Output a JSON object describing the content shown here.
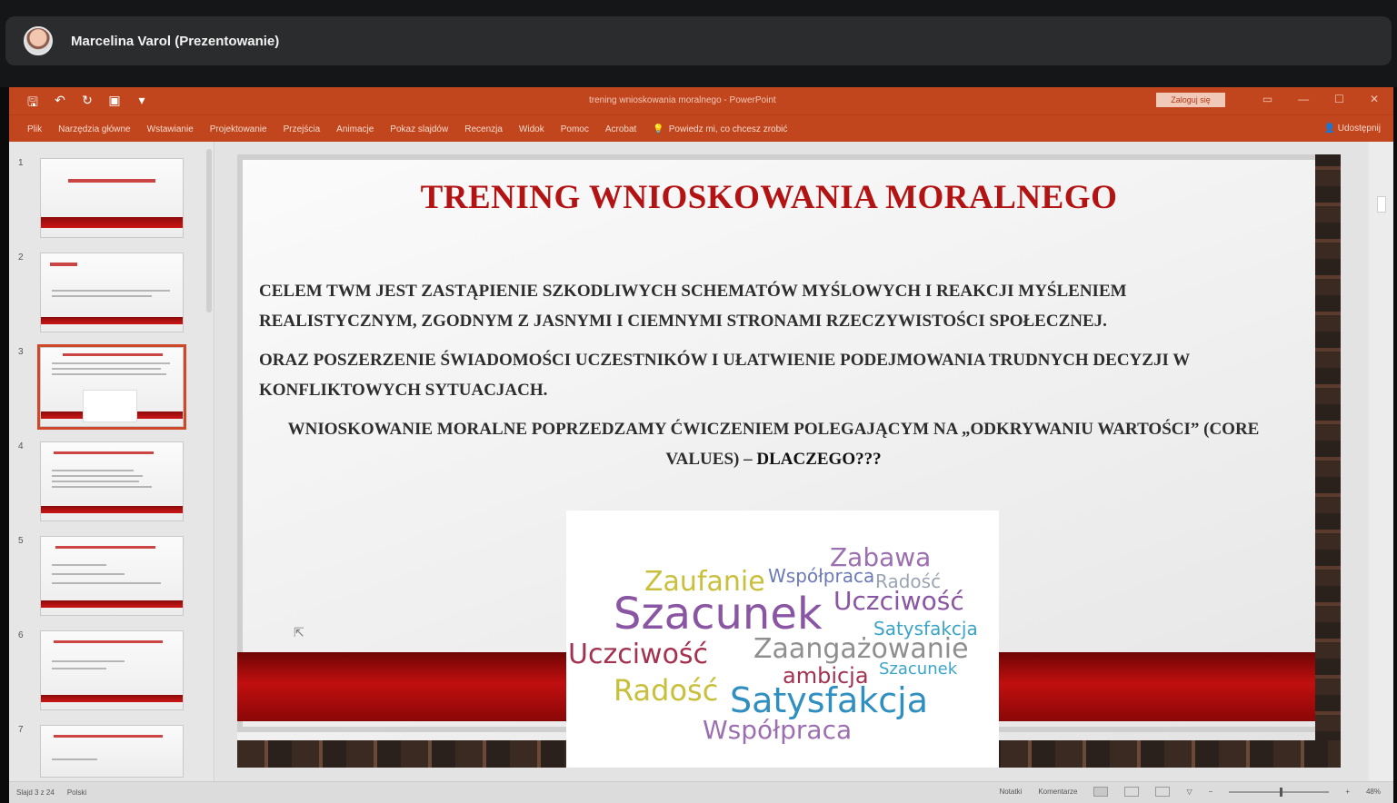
{
  "meeting": {
    "presenter_name": "Marcelina Varol (Prezentowanie)"
  },
  "ppt": {
    "doc_title": "trening wnioskowania moralnego  -  PowerPoint",
    "signin_label": "Zaloguj się",
    "ribbon_tabs": [
      "Plik",
      "Narzędzia główne",
      "Wstawianie",
      "Projektowanie",
      "Przejścia",
      "Animacje",
      "Pokaz slajdów",
      "Recenzja",
      "Widok",
      "Pomoc",
      "Acrobat"
    ],
    "tell_me": "Powiedz mi, co chcesz zrobić",
    "share": "Udostępnij",
    "status_left": [
      "Slajd 3 z 24",
      "Polski"
    ],
    "status_right": [
      "Notatki",
      "Komentarze",
      "48%"
    ],
    "accent": "#c1461e"
  },
  "thumbnails": [
    {
      "num": "1"
    },
    {
      "num": "2"
    },
    {
      "num": "3"
    },
    {
      "num": "4"
    },
    {
      "num": "5"
    },
    {
      "num": "6"
    },
    {
      "num": "7"
    }
  ],
  "slide": {
    "title": "TRENING WNIOSKOWANIA MORALNEGO",
    "para1": "CELEM TWM JEST ZASTĄPIENIE SZKODLIWYCH SCHEMATÓW MYŚLOWYCH I REAKCJI MYŚLENIEM REALISTYCZNYM, ZGODNYM Z JASNYMI I CIEMNYMI STRONAMI RZECZYWISTOŚCI SPOŁECZNEJ.",
    "para2": "ORAZ POSZERZENIE ŚWIADOMOŚCI UCZESTNIKÓW I UŁATWIENIE PODEJMOWANIA TRUDNYCH DECYZJI W KONFLIKTOWYCH SYTUACJACH.",
    "para3": "WNIOSKOWANIE MORALNE POPRZEDZAMY ĆWICZENIEM POLEGAJĄCYM NA „ODKRYWANIU WARTOŚCI” (CORE VALUES) –",
    "para3_bold": "DLACZEGO???",
    "title_color": "#b31313"
  },
  "wordcloud": {
    "words": [
      {
        "text": "Zabawa",
        "color": "#9b6fb0"
      },
      {
        "text": "Zaufanie",
        "color": "#c8bf3a"
      },
      {
        "text": "Współpraca",
        "color": "#6c79b7"
      },
      {
        "text": "Radość",
        "color": "#9aa4b3"
      },
      {
        "text": "Szacunek",
        "color": "#8a55a3"
      },
      {
        "text": "Uczciwość",
        "color": "#8a55a3"
      },
      {
        "text": "Satysfakcja",
        "color": "#3aa4c9"
      },
      {
        "text": "Uczciwość",
        "color": "#a3314f"
      },
      {
        "text": "Zaangażowanie",
        "color": "#8f8f8f"
      },
      {
        "text": "ambicja",
        "color": "#a3314f"
      },
      {
        "text": "Szacunek",
        "color": "#3aa4c9"
      },
      {
        "text": "Radość",
        "color": "#c8bf3a"
      },
      {
        "text": "Satysfakcja",
        "color": "#2e8fc0"
      },
      {
        "text": "Współpraca",
        "color": "#9b6fb0"
      }
    ]
  }
}
